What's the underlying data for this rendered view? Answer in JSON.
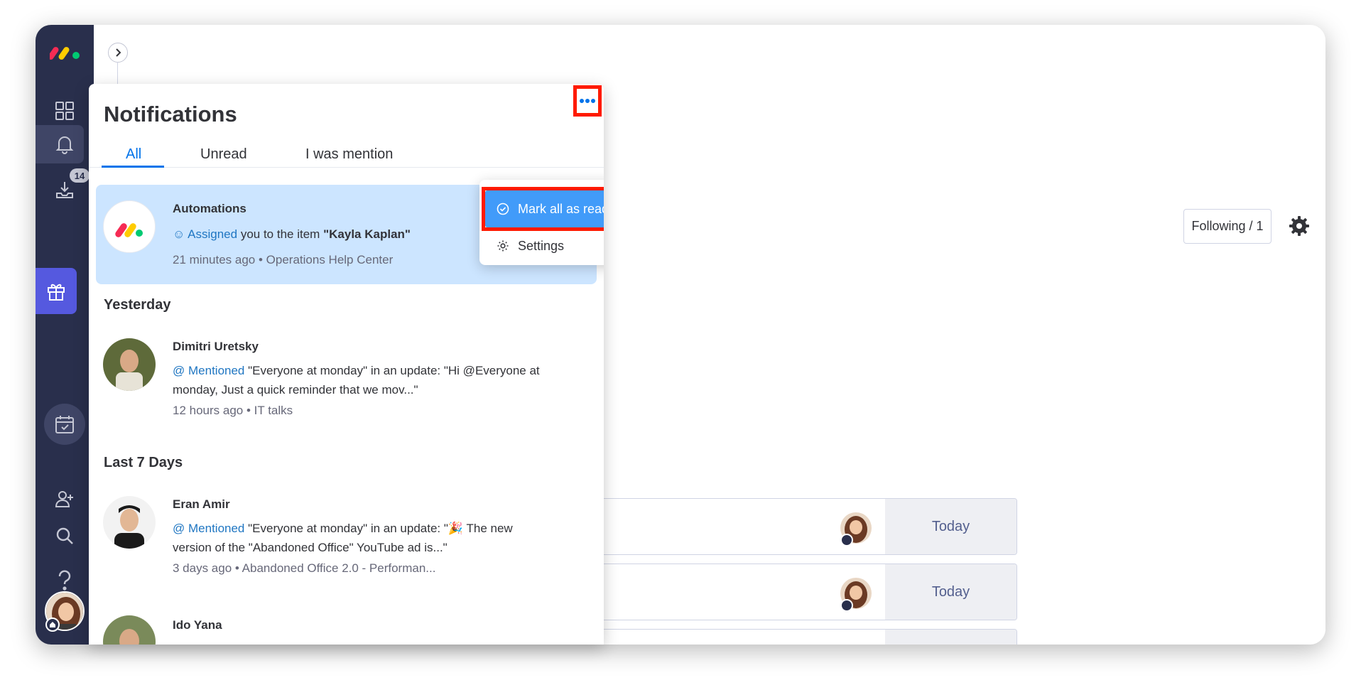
{
  "notifications": {
    "title": "Notifications",
    "tabs": [
      "All",
      "Unread",
      "I was mention"
    ],
    "menu": {
      "mark_all_read": "Mark all as read",
      "settings": "Settings"
    },
    "items": [
      {
        "sender": "Automations",
        "action": "Assigned",
        "text_pre": "you to the item",
        "text_bold": "\"Kayla Kaplan\"",
        "time": "21 minutes ago",
        "source": "Operations Help Center"
      }
    ],
    "sections": {
      "yesterday": "Yesterday",
      "last7": "Last 7 Days"
    },
    "yesterday_items": [
      {
        "sender": "Dimitri Uretsky",
        "action": "Mentioned",
        "text": "\"Everyone at monday\" in an update: \"Hi @Everyone at monday, Just a quick reminder that we mov...\"",
        "time": "12 hours ago",
        "source": "IT talks"
      }
    ],
    "week_items": [
      {
        "sender": "Eran Amir",
        "action": "Mentioned",
        "text": "\"Everyone at monday\" in an update: \"🎉  The new version of the \"Abandoned Office\" YouTube ad is...\"",
        "time": "3 days ago",
        "source": "Abandoned Office 2.0 - Performan..."
      },
      {
        "sender": "Ido Yana"
      }
    ],
    "separator": "•"
  },
  "sidebar": {
    "badge_count": "14"
  },
  "board": {
    "following": "Following / 1",
    "rows": [
      {
        "date": "Today"
      },
      {
        "date": "Today"
      }
    ]
  },
  "colors": {
    "sidebar_bg": "#292f4c",
    "accent_blue": "#0073ea",
    "highlight_red": "#ff1a00",
    "menu_active": "#419bf9",
    "gift_purple": "#5559df"
  }
}
